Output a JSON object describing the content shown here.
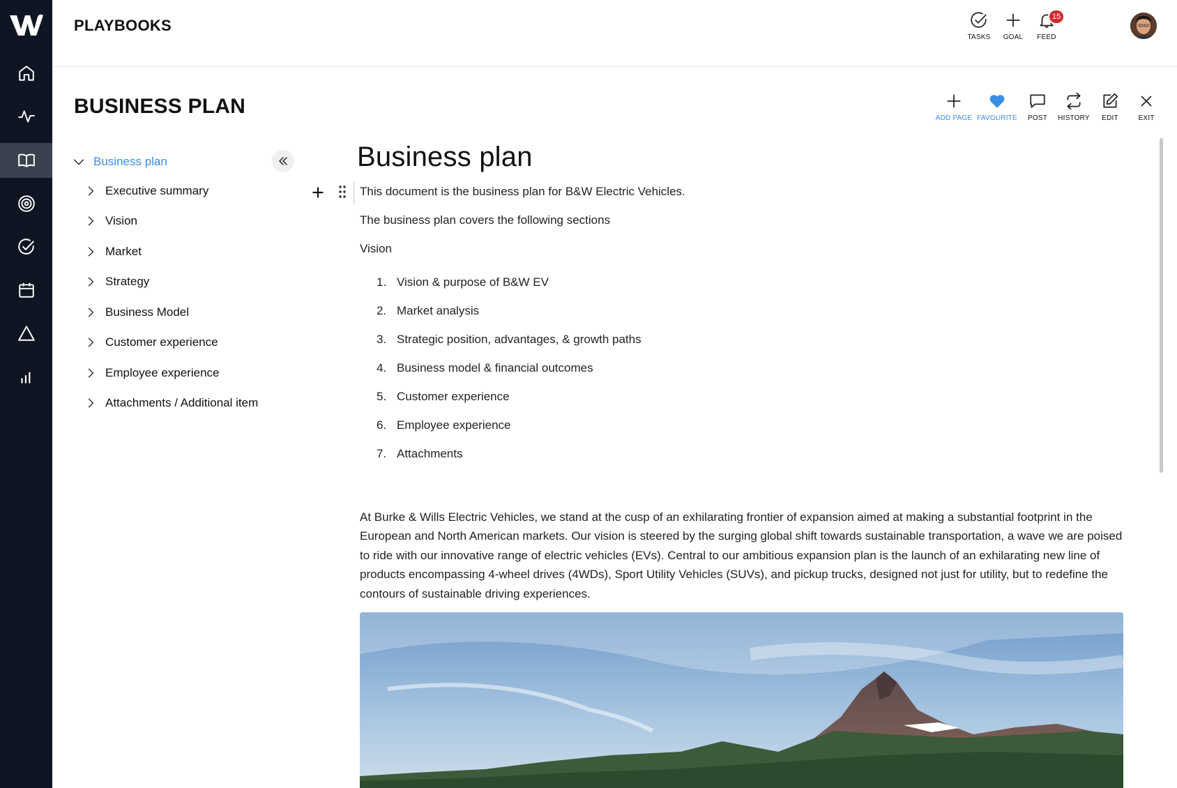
{
  "app": {
    "title": "PLAYBOOKS",
    "logo_icon": "w-logo-icon"
  },
  "rail": {
    "items": [
      {
        "icon": "home-icon",
        "active": false
      },
      {
        "icon": "pulse-icon",
        "active": false
      },
      {
        "icon": "book-icon",
        "active": true
      },
      {
        "icon": "target-icon",
        "active": false
      },
      {
        "icon": "check-circle-icon",
        "active": false
      },
      {
        "icon": "calendar-icon",
        "active": false
      },
      {
        "icon": "triangle-icon",
        "active": false
      },
      {
        "icon": "bar-chart-icon",
        "active": false
      }
    ]
  },
  "topbar": {
    "tasks_label": "TASKS",
    "goal_label": "GOAL",
    "feed_label": "FEED",
    "feed_badge": "15"
  },
  "page": {
    "title": "BUSINESS PLAN",
    "actions": {
      "add_page": "ADD PAGE",
      "favourite": "FAVOURITE",
      "post": "POST",
      "history": "HISTORY",
      "edit": "EDIT",
      "exit": "EXIT"
    }
  },
  "tree": {
    "root": "Business plan",
    "items": [
      "Executive summary",
      "Vision",
      "Market",
      "Strategy",
      "Business Model",
      "Customer experience",
      "Employee experience",
      "Attachments / Additional item"
    ]
  },
  "doc": {
    "title": "Business plan",
    "intro": "This document is the business plan for B&W Electric Vehicles.",
    "sections_intro": "The business plan covers the following sections",
    "vision_label": "Vision",
    "list": [
      {
        "num": "1.",
        "text": "Vision & purpose of B&W EV"
      },
      {
        "num": "2.",
        "text": "Market analysis"
      },
      {
        "num": "3.",
        "text": "Strategic position, advantages, & growth paths"
      },
      {
        "num": "4.",
        "text": "Business model & financial outcomes"
      },
      {
        "num": "5.",
        "text": "Customer experience"
      },
      {
        "num": "6.",
        "text": "Employee experience"
      },
      {
        "num": "7.",
        "text": "Attachments"
      }
    ],
    "body": "At Burke & Wills Electric Vehicles, we stand at the cusp of an exhilarating frontier of expansion aimed at making a substantial footprint in the European and North American markets. Our vision is steered by the surging global shift towards sustainable transportation, a wave we are poised to ride with our innovative range of electric vehicles (EVs). Central to our ambitious expansion plan is the launch of an exhilarating new line of products encompassing 4-wheel drives (4WDs), Sport Utility Vehicles (SUVs), and pickup trucks, designed not just for utility, but to redefine the contours of sustainable driving experiences."
  },
  "colors": {
    "rail_bg": "#0f1623",
    "rail_active": "#3a4250",
    "accent_blue": "#3a8ee6",
    "badge_red": "#d02a2a"
  }
}
